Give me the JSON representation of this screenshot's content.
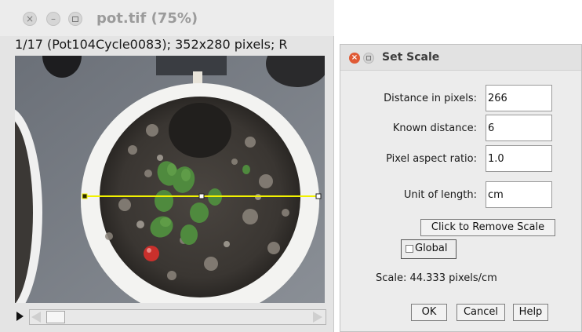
{
  "image_window": {
    "title": "pot.tif (75%)",
    "subtitle": "1/17 (Pot104Cycle0083); 352x280 pixels; R",
    "buttons": {
      "close": "×",
      "minimize": "–"
    }
  },
  "dialog": {
    "title": "Set Scale",
    "close_glyph": "×",
    "fields": [
      {
        "label": "Distance in pixels:",
        "value": "266"
      },
      {
        "label": "Known distance:",
        "value": "6"
      },
      {
        "label": "Pixel aspect ratio:",
        "value": "1.0"
      },
      {
        "label": "Unit of length:",
        "value": "cm"
      }
    ],
    "remove_scale_label": "Click to Remove Scale",
    "global_label": "Global",
    "global_checked": false,
    "scale_text": "Scale: 44.333 pixels/cm",
    "buttons": {
      "ok": "OK",
      "cancel": "Cancel",
      "help": "Help"
    }
  },
  "colors": {
    "selection_line": "#f2f200",
    "dialog_close": "#e05a35"
  },
  "icons": [
    "close-icon",
    "minimize-icon",
    "maximize-icon",
    "play-icon",
    "scroll-left-icon",
    "scroll-right-icon"
  ]
}
